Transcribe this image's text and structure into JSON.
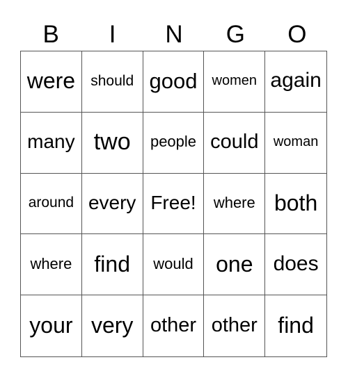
{
  "header": [
    "B",
    "I",
    "N",
    "G",
    "O"
  ],
  "cells": [
    [
      "were",
      "should",
      "good",
      "women",
      "again"
    ],
    [
      "many",
      "two",
      "people",
      "could",
      "woman"
    ],
    [
      "around",
      "every",
      "Free!",
      "where",
      "both"
    ],
    [
      "where",
      "find",
      "would",
      "one",
      "does"
    ],
    [
      "your",
      "very",
      "other",
      "other",
      "find"
    ]
  ]
}
